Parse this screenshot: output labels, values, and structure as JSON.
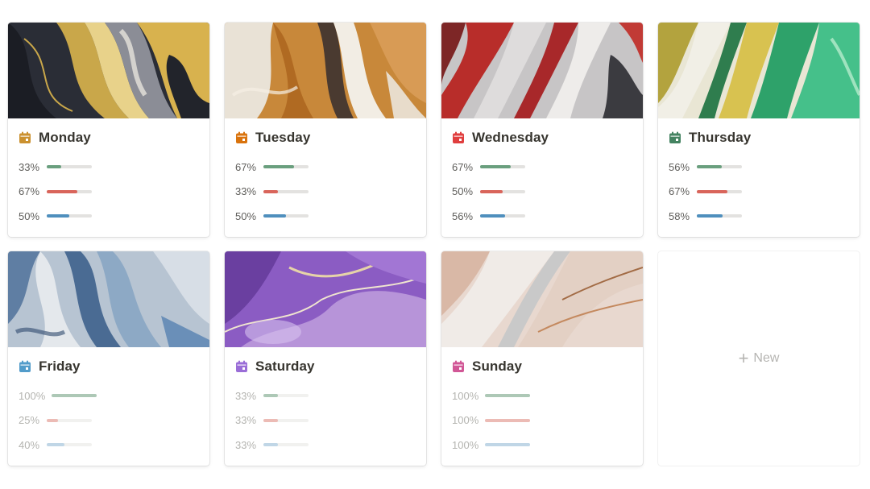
{
  "cards": [
    {
      "title": "Monday",
      "icon": "calendar-icon",
      "color": "#cb912f",
      "stats": [
        {
          "label": "33%",
          "value": 0.33,
          "color": "#6a9f7e"
        },
        {
          "label": "67%",
          "value": 0.67,
          "color": "#d9655b"
        },
        {
          "label": "50%",
          "value": 0.5,
          "color": "#4f8fbd"
        }
      ]
    },
    {
      "title": "Tuesday",
      "icon": "calendar-icon",
      "color": "#d9730d",
      "stats": [
        {
          "label": "67%",
          "value": 0.67,
          "color": "#6a9f7e"
        },
        {
          "label": "33%",
          "value": 0.33,
          "color": "#d9655b"
        },
        {
          "label": "50%",
          "value": 0.5,
          "color": "#4f8fbd"
        }
      ]
    },
    {
      "title": "Wednesday",
      "icon": "calendar-icon",
      "color": "#e03e3e",
      "stats": [
        {
          "label": "67%",
          "value": 0.67,
          "color": "#6a9f7e"
        },
        {
          "label": "50%",
          "value": 0.5,
          "color": "#d9655b"
        },
        {
          "label": "56%",
          "value": 0.56,
          "color": "#4f8fbd"
        }
      ]
    },
    {
      "title": "Thursday",
      "icon": "calendar-icon",
      "color": "#448361",
      "stats": [
        {
          "label": "56%",
          "value": 0.56,
          "color": "#6a9f7e"
        },
        {
          "label": "67%",
          "value": 0.67,
          "color": "#d9655b"
        },
        {
          "label": "58%",
          "value": 0.58,
          "color": "#4f8fbd"
        }
      ]
    },
    {
      "title": "Friday",
      "icon": "calendar-icon",
      "color": "#529cca",
      "stats": [
        {
          "label": "100%",
          "value": 1.0,
          "color": "#6a9f7e"
        },
        {
          "label": "25%",
          "value": 0.25,
          "color": "#e8867c"
        },
        {
          "label": "40%",
          "value": 0.4,
          "color": "#8fbbdd"
        }
      ]
    },
    {
      "title": "Saturday",
      "icon": "calendar-icon",
      "color": "#9a6dd7",
      "stats": [
        {
          "label": "33%",
          "value": 0.33,
          "color": "#6a9f7e"
        },
        {
          "label": "33%",
          "value": 0.33,
          "color": "#e8867c"
        },
        {
          "label": "33%",
          "value": 0.33,
          "color": "#8fbbdd"
        }
      ]
    },
    {
      "title": "Sunday",
      "icon": "calendar-icon",
      "color": "#d15796",
      "stats": [
        {
          "label": "100%",
          "value": 1.0,
          "color": "#6a9f7e"
        },
        {
          "label": "100%",
          "value": 1.0,
          "color": "#e8867c"
        },
        {
          "label": "100%",
          "value": 1.0,
          "color": "#8fbbdd"
        }
      ]
    }
  ],
  "new_card": {
    "label": "New",
    "icon": "plus-icon"
  }
}
